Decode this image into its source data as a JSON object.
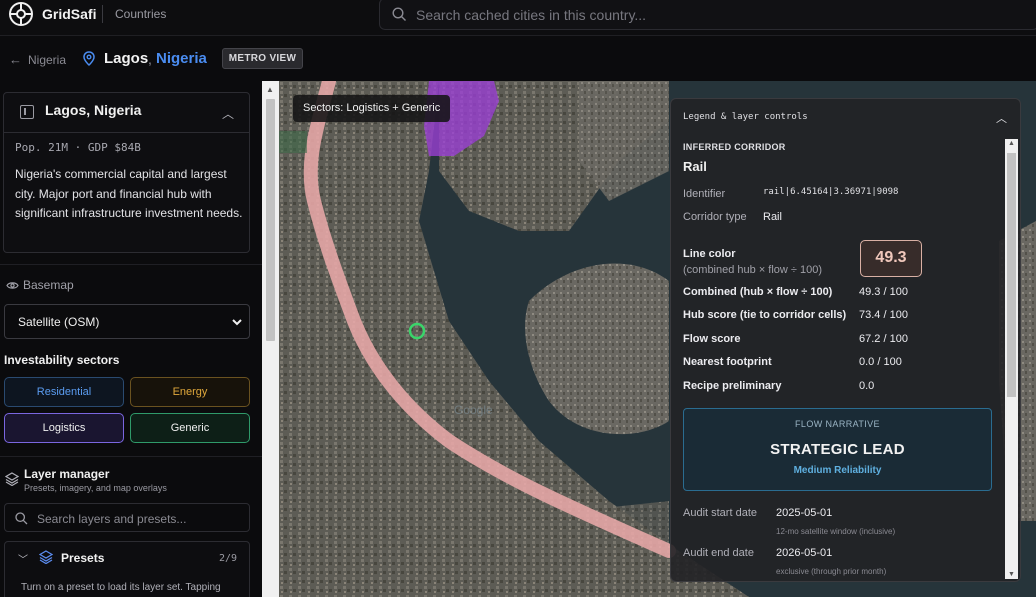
{
  "app": {
    "name": "GridSafi",
    "nav_countries": "Countries"
  },
  "search": {
    "placeholder": "Search cached cities in this country..."
  },
  "breadcrumb": {
    "back_label": "Nigeria",
    "city": "Lagos",
    "separator": ",",
    "country": "Nigeria",
    "view_button": "METRO VIEW"
  },
  "city_card": {
    "title": "Lagos, Nigeria",
    "stats": "Pop. 21M · GDP $84B",
    "description": "Nigeria's commercial capital and largest city. Major port and financial hub with significant infrastructure investment needs."
  },
  "basemap": {
    "label": "Basemap",
    "selected": "Satellite (OSM)"
  },
  "sectors": {
    "title": "Investability sectors",
    "items": [
      {
        "label": "Residential",
        "active": false
      },
      {
        "label": "Energy",
        "active": false
      },
      {
        "label": "Logistics",
        "active": true
      },
      {
        "label": "Generic",
        "active": true
      }
    ]
  },
  "layer_manager": {
    "title": "Layer manager",
    "subtitle": "Presets, imagery, and map overlays",
    "search_placeholder": "Search layers and presets...",
    "presets": {
      "label": "Presets",
      "count": "2/9",
      "note": "Turn on a preset to load its layer set. Tapping"
    }
  },
  "map": {
    "sectors_chip": "Sectors: Logistics + Generic",
    "watermark": "Google",
    "colors": {
      "corridor": "#e8a0a0",
      "logistics_zone": "#9b3fd6",
      "water": "#1f2e35",
      "land": "#5a5a52"
    }
  },
  "legend": {
    "header": "Legend & layer controls",
    "section": "INFERRED CORRIDOR",
    "corridor_name": "Rail",
    "identifier_label": "Identifier",
    "identifier": "rail|6.45164|3.36971|9098",
    "corridor_type_label": "Corridor type",
    "corridor_type": "Rail",
    "line_color_label": "Line color",
    "line_color_sub": "(combined hub × flow ÷ 100)",
    "line_color_value": "49.3",
    "metrics": [
      {
        "label": "Combined (hub × flow ÷ 100)",
        "value": "49.3 / 100"
      },
      {
        "label": "Hub score (tie to corridor cells)",
        "value": "73.4 / 100"
      },
      {
        "label": "Flow score",
        "value": "67.2 / 100"
      },
      {
        "label": "Nearest footprint",
        "value": "0.0 / 100"
      },
      {
        "label": "Recipe preliminary",
        "value": "0.0"
      }
    ],
    "narrative": {
      "label": "FLOW NARRATIVE",
      "title": "STRATEGIC LEAD",
      "reliability": "Medium Reliability"
    },
    "audit": [
      {
        "label": "Audit start date",
        "value": "2025-05-01",
        "note": "12-mo satellite window (inclusive)"
      },
      {
        "label": "Audit end date",
        "value": "2026-05-01",
        "note": "exclusive (through prior month)"
      }
    ]
  }
}
